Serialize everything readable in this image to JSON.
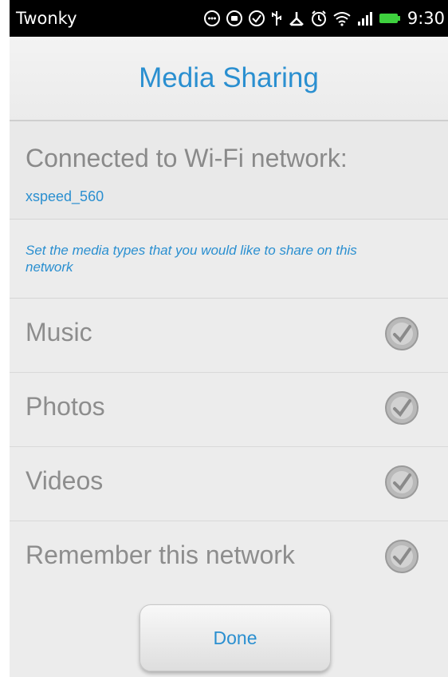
{
  "statusbar": {
    "app_name": "Twonky",
    "time": "9:30",
    "icons": [
      "smile-icon",
      "circle-icon",
      "check-circle-icon",
      "usb-icon",
      "debug-icon",
      "alarm-icon",
      "wifi-icon",
      "signal-icon",
      "battery-icon"
    ]
  },
  "header": {
    "title": "Media Sharing"
  },
  "network": {
    "label": "Connected to Wi-Fi network:",
    "name": "xspeed_560"
  },
  "hint": {
    "line1": "Set the media types that you would like to share on this",
    "line2": "network"
  },
  "options": [
    {
      "label": "Music",
      "checked": true
    },
    {
      "label": "Photos",
      "checked": true
    },
    {
      "label": "Videos",
      "checked": true
    },
    {
      "label": "Remember this network",
      "checked": true
    }
  ],
  "done_label": "Done",
  "colors": {
    "accent": "#2a8fd0",
    "text_muted": "#8d8d8d"
  }
}
